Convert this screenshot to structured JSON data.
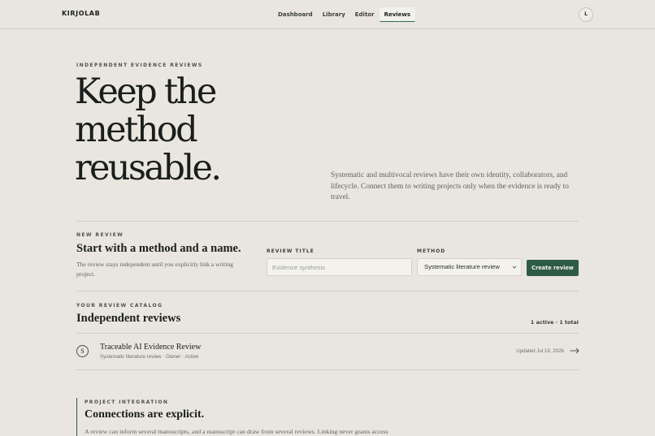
{
  "header": {
    "brand": "KIRJOLAB",
    "nav": [
      "Dashboard",
      "Library",
      "Editor",
      "Reviews"
    ],
    "active_nav": "Reviews",
    "avatar_initial": "L"
  },
  "hero": {
    "eyebrow": "INDEPENDENT EVIDENCE REVIEWS",
    "title_line1": "Keep the",
    "title_line2": "method",
    "title_line3": "reusable.",
    "lede": "Systematic and multivocal reviews have their own identity, collaborators, and lifecycle. Connect them to writing projects only when the evidence is ready to travel."
  },
  "new_review": {
    "eyebrow": "NEW REVIEW",
    "title": "Start with a method and a name.",
    "description": "The review stays independent until you explicitly link a writing project.",
    "title_label": "REVIEW TITLE",
    "title_placeholder": "Evidence synthesis",
    "title_value": "",
    "method_label": "METHOD",
    "method_value": "Systematic literature review",
    "create_label": "Create review"
  },
  "catalog": {
    "eyebrow": "YOUR REVIEW CATALOG",
    "title": "Independent reviews",
    "count": "1 active · 1 total",
    "reviews": [
      {
        "initial": "S",
        "name": "Traceable AI Evidence Review",
        "meta": "Systematic literature review · Owner · Active",
        "updated": "Updated Jul 19, 2026"
      }
    ]
  },
  "integration": {
    "eyebrow": "PROJECT INTEGRATION",
    "title": "Connections are explicit.",
    "text": "A review can inform several manuscripts, and a manuscript can draw from several reviews. Linking never grants access"
  },
  "colors": {
    "background": "#e9e6df",
    "accent": "#2e5b45",
    "text": "#1a1e1b",
    "muted": "#5c625d"
  }
}
